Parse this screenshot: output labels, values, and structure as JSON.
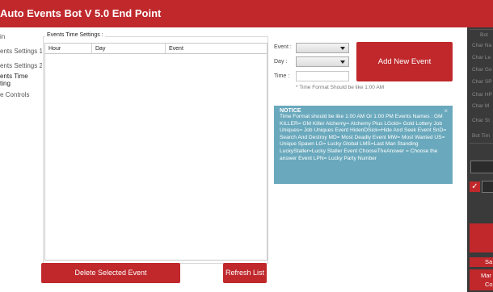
{
  "window": {
    "title": "Auto Events Bot V 5.0 End Point"
  },
  "nav": {
    "items": [
      {
        "label": "in"
      },
      {
        "label": "ents Settings 1"
      },
      {
        "label": "ents Settings 2"
      },
      {
        "label": "ents Time"
      },
      {
        "label": "ting"
      },
      {
        "label": "e Controls"
      }
    ]
  },
  "events_group": {
    "label": "Events Time Settings :",
    "columns": [
      "Hour",
      "Day",
      "Event"
    ]
  },
  "buttons": {
    "delete": "Delete Selected Event",
    "refresh": "Refresh List",
    "add": "Add New Event"
  },
  "form": {
    "event_label": "Event :",
    "day_label": "Day :",
    "time_label": "Time :",
    "time_value": "",
    "event_value": "",
    "day_value": "",
    "hint": "* Time Format Should be like 1:00 AM"
  },
  "notice": {
    "title": "NOTICE",
    "close": "×",
    "body": "Time Format should be like 1:00 AM Or 1:00 PM  Events Names :   GM KILLER= GM Killer   Alchemy= Alchemy Plus LGold= Gold Lottery   Job Uniques= Job Uniques Event HidenDSick=Hide And Seek Event   SnD= Search And Destroy MD= Most Deadly Event   MW= Most Wanted   US= Unique Spawn   LG= Lucky Global  LMS=Last Man Standing LuckyStaller=Lucky Staller Event   ChooseTheAnswer = Choose the answer Event   LPN= Lucky Party Number"
  },
  "right_panel": {
    "labels": [
      "Bot",
      "Char Na",
      "Char Le",
      "Char Go",
      "Char SP",
      "Char HP",
      "Char M",
      "Char St",
      "Bot Tim"
    ],
    "checkbox_mark": "✓",
    "btn1": "Sa",
    "btn2": "Mar",
    "btn2b": "Co"
  },
  "colors": {
    "accent": "#c0282c",
    "notice_bg": "#6aa9bd",
    "panel_dark": "#3a3a3a"
  }
}
